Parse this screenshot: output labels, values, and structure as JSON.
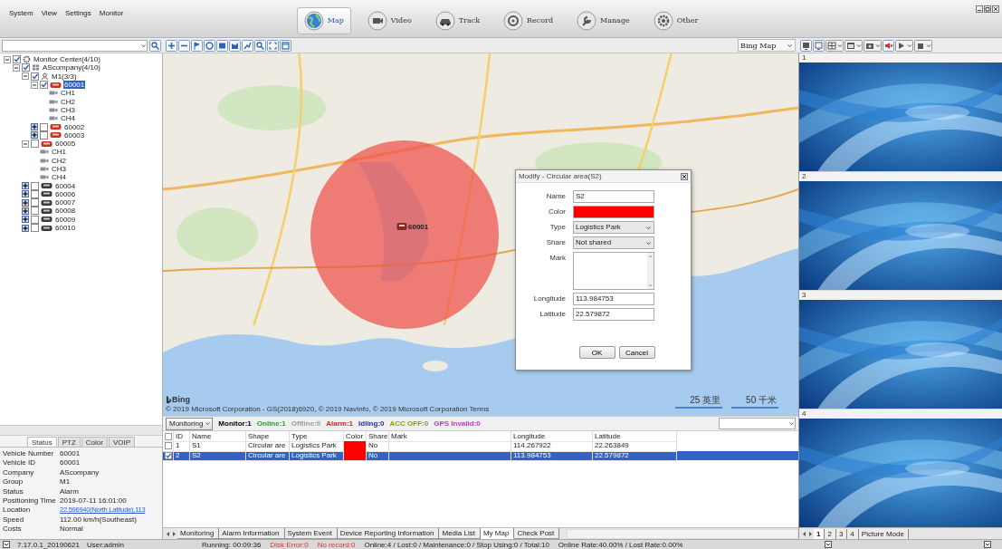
{
  "menu": [
    "System",
    "View",
    "Settings",
    "Monitor"
  ],
  "nav": [
    {
      "label": "Map",
      "selected": true
    },
    {
      "label": "Video",
      "selected": false
    },
    {
      "label": "Track",
      "selected": false
    },
    {
      "label": "Record",
      "selected": false
    },
    {
      "label": "Manage",
      "selected": false
    },
    {
      "label": "Other",
      "selected": false
    }
  ],
  "map_source": "Bing Map",
  "tree": [
    {
      "label": "Monitor Center(4/10)",
      "kind": "center",
      "checked": true,
      "expanded": true,
      "selected": false,
      "children": [
        {
          "label": "AScompany(4/10)",
          "kind": "company",
          "checked": true,
          "expanded": true,
          "selected": false,
          "children": [
            {
              "label": "M1(3/3)",
              "kind": "group",
              "checked": true,
              "expanded": true,
              "selected": false,
              "children": [
                {
                  "label": "60001",
                  "kind": "vehicle",
                  "online": true,
                  "checked": true,
                  "expanded": true,
                  "selected": true,
                  "children": [
                    {
                      "label": "CH1",
                      "kind": "channel",
                      "selected": false
                    },
                    {
                      "label": "CH2",
                      "kind": "channel",
                      "selected": false
                    },
                    {
                      "label": "CH3",
                      "kind": "channel",
                      "selected": false
                    },
                    {
                      "label": "CH4",
                      "kind": "channel",
                      "selected": false
                    }
                  ]
                },
                {
                  "label": "60002",
                  "kind": "vehicle",
                  "online": true,
                  "checked": false,
                  "expanded": false,
                  "selected": false
                },
                {
                  "label": "60003",
                  "kind": "vehicle",
                  "online": true,
                  "checked": false,
                  "expanded": false,
                  "selected": false
                }
              ]
            },
            {
              "label": "60005",
              "kind": "vehicle",
              "online": true,
              "checked": false,
              "expanded": true,
              "selected": false,
              "children": [
                {
                  "label": "CH1",
                  "kind": "channel",
                  "selected": false
                },
                {
                  "label": "CH2",
                  "kind": "channel",
                  "selected": false
                },
                {
                  "label": "CH3",
                  "kind": "channel",
                  "selected": false
                },
                {
                  "label": "CH4",
                  "kind": "channel",
                  "selected": false
                }
              ]
            },
            {
              "label": "60004",
              "kind": "vehicle",
              "online": false,
              "checked": false,
              "expanded": false,
              "selected": false
            },
            {
              "label": "60006",
              "kind": "vehicle",
              "online": false,
              "checked": false,
              "expanded": false,
              "selected": false
            },
            {
              "label": "60007",
              "kind": "vehicle",
              "online": false,
              "checked": false,
              "expanded": false,
              "selected": false
            },
            {
              "label": "60008",
              "kind": "vehicle",
              "online": false,
              "checked": false,
              "expanded": false,
              "selected": false
            },
            {
              "label": "60009",
              "kind": "vehicle",
              "online": false,
              "checked": false,
              "expanded": false,
              "selected": false
            },
            {
              "label": "60010",
              "kind": "vehicle",
              "online": false,
              "checked": false,
              "expanded": false,
              "selected": false
            }
          ]
        }
      ]
    }
  ],
  "vehicle_props": {
    "tabs": [
      {
        "label": "Status",
        "selected": true
      },
      {
        "label": "PTZ",
        "selected": false
      },
      {
        "label": "Color",
        "selected": false
      },
      {
        "label": "VOIP",
        "selected": false
      }
    ],
    "rows": [
      {
        "label": "Vehicle Number",
        "value": "60001"
      },
      {
        "label": "Vehicle ID",
        "value": "60001"
      },
      {
        "label": "Company",
        "value": "AScompany"
      },
      {
        "label": "Group",
        "value": "M1"
      },
      {
        "label": "Status",
        "value": "Alarm"
      },
      {
        "label": "Positioning Time",
        "value": "2019-07-11 16:01:00"
      },
      {
        "label": "Location",
        "value": "22.596940(North Latitude),113",
        "kind": "link"
      },
      {
        "label": "Speed",
        "value": "112.00 km/h(Southeast)"
      },
      {
        "label": "Costs",
        "value": "Normal"
      }
    ]
  },
  "map": {
    "marker_label": "60001",
    "logo": "Bing",
    "copyright": "© 2019 Microsoft Corporation - GS(2018)6920, © 2019 NavInfo, © 2019 Microsoft Corporation Terms",
    "scales": [
      "25 英里",
      "50 千米"
    ]
  },
  "dialog": {
    "title": "Modify - Circular area(S2)",
    "fields": [
      {
        "label": "Name",
        "kind": "text",
        "value": "S2"
      },
      {
        "label": "Color",
        "kind": "color",
        "color": "#ff0000"
      },
      {
        "label": "Type",
        "kind": "select",
        "value": "Logistics Park"
      },
      {
        "label": "Share",
        "kind": "select",
        "value": "Not shared"
      },
      {
        "label": "Mark",
        "kind": "textarea"
      },
      {
        "label": "Longitude",
        "kind": "text",
        "value": "113.984753"
      },
      {
        "label": "Latitude",
        "kind": "text",
        "value": "22.579872"
      }
    ],
    "buttons": [
      "OK",
      "Cancel"
    ]
  },
  "monitor_bar": {
    "mode": "Monitoring",
    "counts": [
      {
        "text": "Monitor:1",
        "color": "#000000"
      },
      {
        "text": "Online:1",
        "color": "#2a9a2a"
      },
      {
        "text": "Offline:0",
        "color": "#9a9a9a"
      },
      {
        "text": "Alarm:1",
        "color": "#e02020"
      },
      {
        "text": "Idling:0",
        "color": "#2030c0"
      },
      {
        "text": "ACC OFF:0",
        "color": "#8aa000"
      },
      {
        "text": "GPS Invalid:0",
        "color": "#d030d0"
      }
    ]
  },
  "table": {
    "all_checked": false,
    "columns": [
      "ID",
      "Name",
      "Shape",
      "Type",
      "Color",
      "Share",
      "Mark",
      "Longitude",
      "Latitude"
    ],
    "rows": [
      {
        "checked": false,
        "selected": false,
        "id": "1",
        "name": "S1",
        "shape": "Circular are",
        "type": "Logistics Park",
        "color": "#ff0000",
        "share": "No",
        "longitude": "114.267922",
        "latitude": "22.263849"
      },
      {
        "checked": true,
        "selected": true,
        "id": "2",
        "name": "S2",
        "shape": "Circular are",
        "type": "Logistics Park",
        "color": "#ff0000",
        "share": "No",
        "longitude": "113.984753",
        "latitude": "22.579872"
      }
    ]
  },
  "bottom_tabs": [
    {
      "label": "Monitoring",
      "selected": false
    },
    {
      "label": "Alarm Information",
      "selected": false
    },
    {
      "label": "System Event",
      "selected": false
    },
    {
      "label": "Device Reporting Information",
      "selected": false
    },
    {
      "label": "Media List",
      "selected": false
    },
    {
      "label": "My Map",
      "selected": true
    },
    {
      "label": "Check Post",
      "selected": false
    }
  ],
  "video": {
    "tiles": [
      "1",
      "2",
      "3",
      "4"
    ],
    "pages": [
      {
        "label": "1",
        "selected": true
      },
      {
        "label": "2",
        "selected": false
      },
      {
        "label": "3",
        "selected": false
      },
      {
        "label": "4",
        "selected": false
      },
      {
        "label": "Picture Mode",
        "selected": false
      }
    ]
  },
  "status_bar": {
    "version": "7.17.0.1_20190621",
    "user": "User:admin",
    "running": "Running: 00:09:36",
    "disk_error": "Disk Error:0",
    "no_record": "No record:0",
    "totals": "Online:4 / Lost:0 / Maintenance:0 / Stop Using:0 / Total:10",
    "rates": "Online Rate:40.00% / Lost Rate:0.00%"
  }
}
